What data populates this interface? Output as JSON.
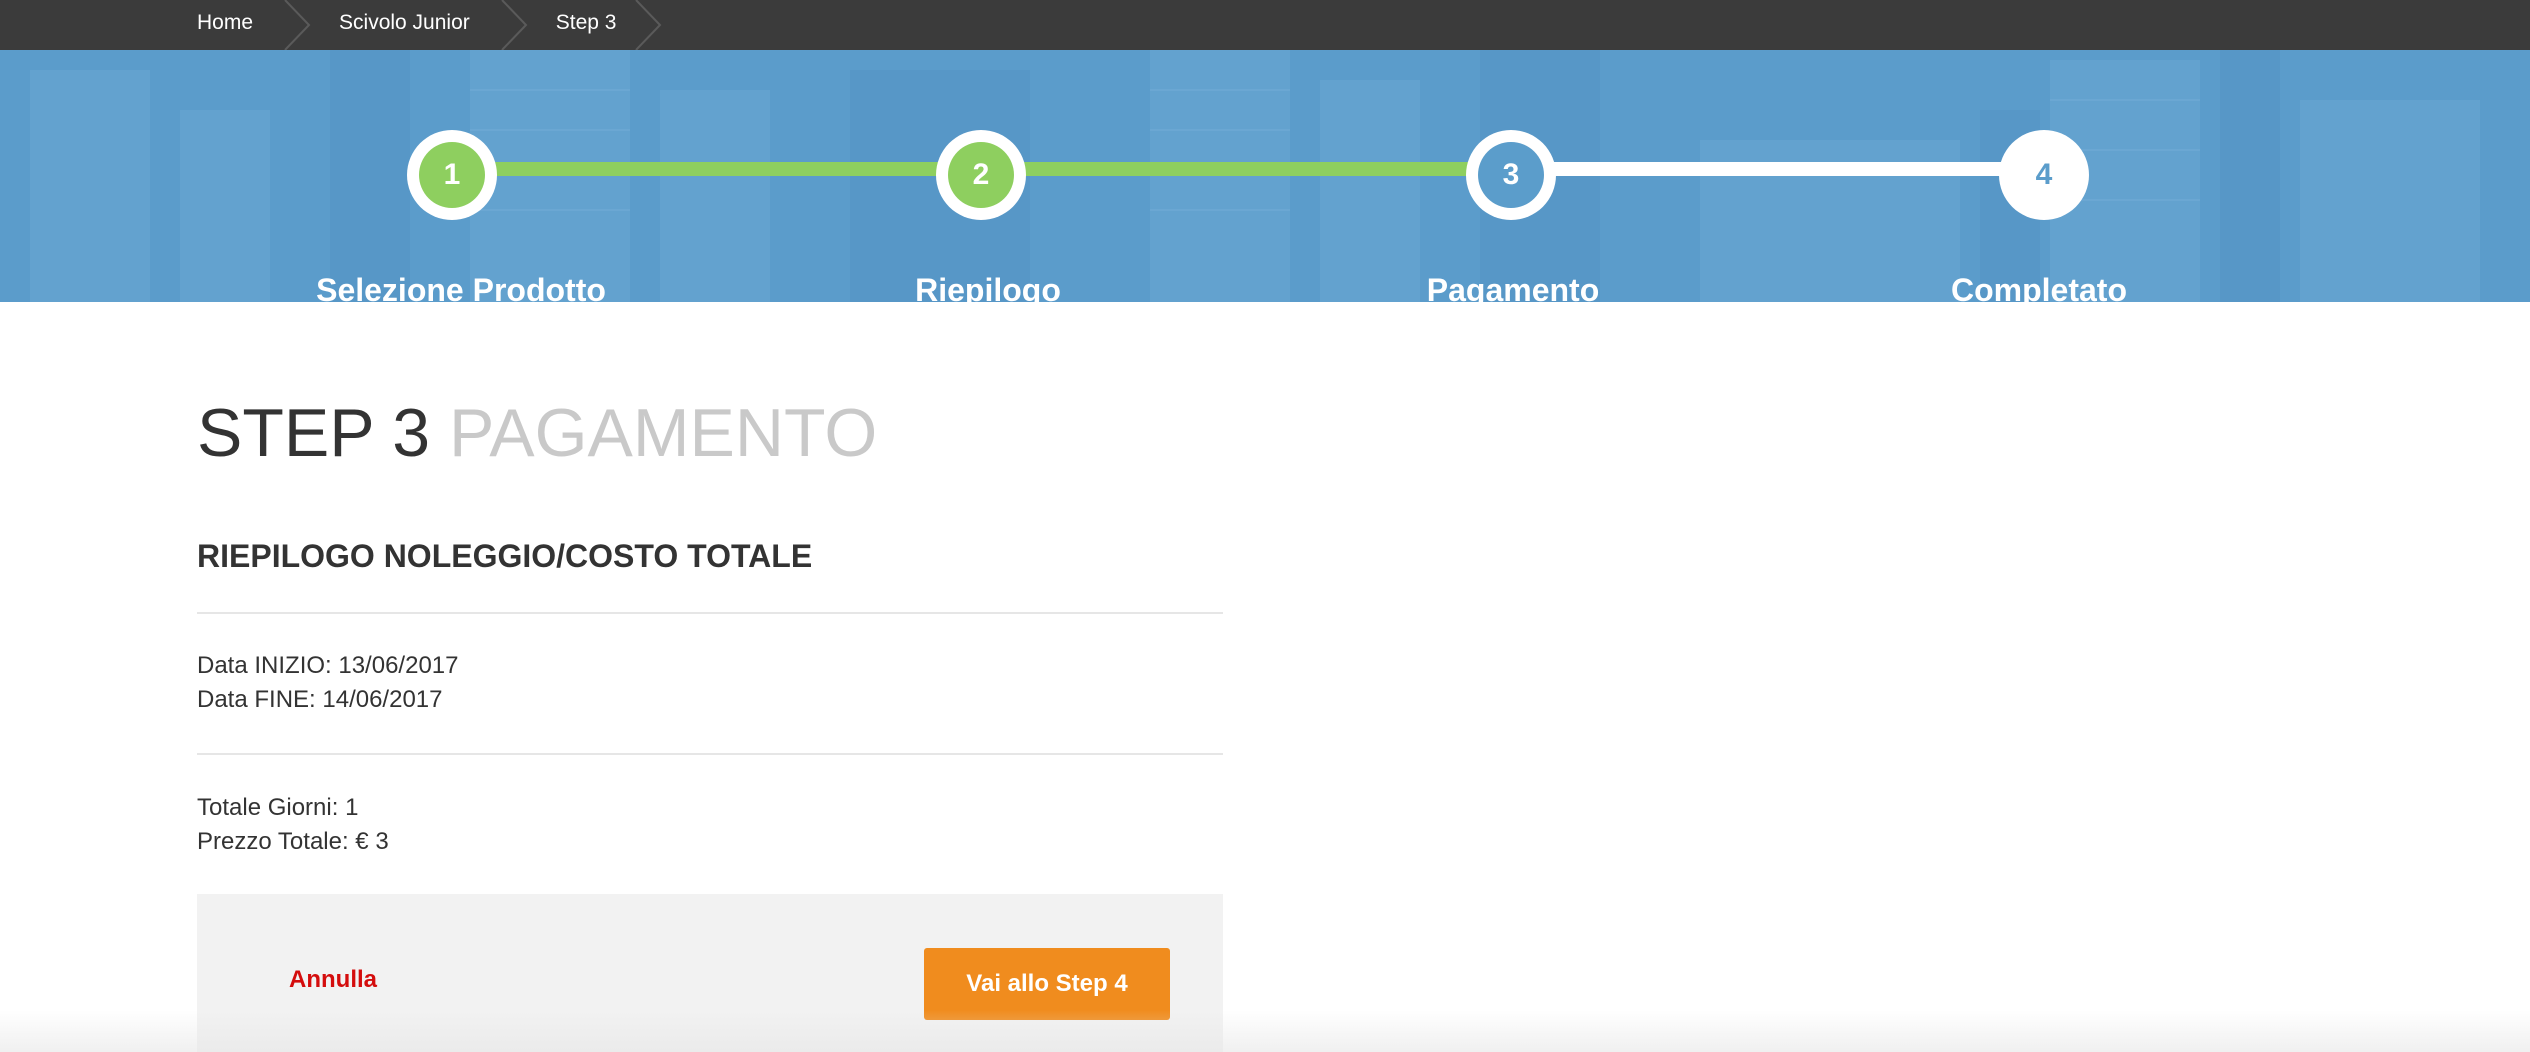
{
  "breadcrumb": {
    "items": [
      {
        "label": "Home"
      },
      {
        "label": "Scivolo Junior"
      },
      {
        "label": "Step 3"
      }
    ]
  },
  "stepper": {
    "steps": [
      {
        "number": "1",
        "label": "Selezione Prodotto",
        "state": "completed"
      },
      {
        "number": "2",
        "label": "Riepilogo",
        "state": "completed"
      },
      {
        "number": "3",
        "label": "Pagamento",
        "state": "current"
      },
      {
        "number": "4",
        "label": "Completato",
        "state": "upcoming"
      }
    ],
    "colors": {
      "completed": "#8ecf5f",
      "current": "#5b9dcb",
      "background": "#5b9ccb"
    }
  },
  "page": {
    "title_step": "STEP 3",
    "title_name": "PAGAMENTO"
  },
  "summary": {
    "heading": "RIEPILOGO NOLEGGIO/COSTO TOTALE",
    "start_date": "Data INIZIO: 13/06/2017",
    "end_date": "Data FINE: 14/06/2017",
    "total_days": "Totale Giorni: 1",
    "total_price": "Prezzo Totale: € 3"
  },
  "actions": {
    "cancel_label": "Annulla",
    "next_label": "Vai allo Step 4",
    "cancel_color": "#d40d0d",
    "next_color": "#f08c1e"
  }
}
